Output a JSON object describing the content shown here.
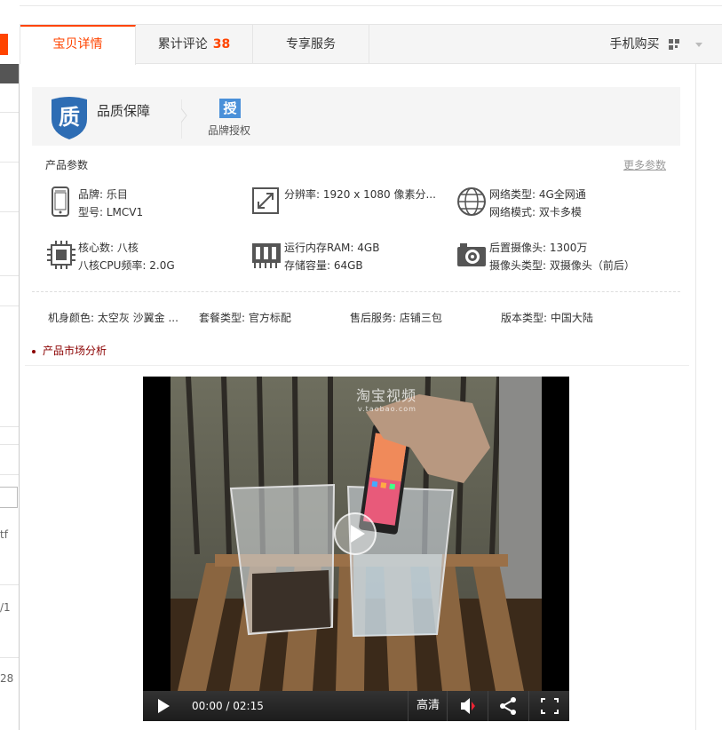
{
  "sidebar_fragments": {
    "frag1": "tf",
    "frag2": "/1",
    "frag3": "28"
  },
  "tabs": [
    {
      "label": "宝贝详情",
      "active": true
    },
    {
      "label": "累计评论",
      "count": "38"
    },
    {
      "label": "专享服务"
    }
  ],
  "mobile_buy": {
    "label": "手机购买",
    "icon": "qr-code-icon"
  },
  "guarantee": {
    "title": "品质保障",
    "shield_char": "质",
    "auth_char": "授",
    "auth_label": "品牌授权"
  },
  "params": {
    "title": "产品参数",
    "more": "更多参数",
    "items": [
      {
        "icon": "phone-icon",
        "line1": "品牌: 乐目",
        "line2": "型号: LMCV1"
      },
      {
        "icon": "resolution-icon",
        "line1": "分辨率: 1920 x 1080 像素分...",
        "line2": ""
      },
      {
        "icon": "globe-icon",
        "line1": "网络类型: 4G全网通",
        "line2": "网络模式: 双卡多模"
      },
      {
        "icon": "cpu-icon",
        "line1": "核心数: 八核",
        "line2": "八核CPU频率: 2.0G"
      },
      {
        "icon": "ram-icon",
        "line1": "运行内存RAM: 4GB",
        "line2": "存储容量: 64GB"
      },
      {
        "icon": "camera-icon",
        "line1": "后置摄像头: 1300万",
        "line2": "摄像头类型: 双摄像头（前后）"
      }
    ],
    "attrs": [
      "机身颜色: 太空灰 沙翼金 ...",
      "套餐类型: 官方标配",
      "售后服务: 店铺三包",
      "版本类型: 中国大陆"
    ]
  },
  "market": {
    "label": "产品市场分析"
  },
  "video": {
    "watermark": "淘宝视频",
    "watermark_sub": "v.taobao.com",
    "time": "00:00 / 02:15",
    "hd_label": "高清"
  },
  "colors": {
    "accent": "#ff4400",
    "auth_blue": "#4a90d9",
    "market": "#8b0000"
  }
}
